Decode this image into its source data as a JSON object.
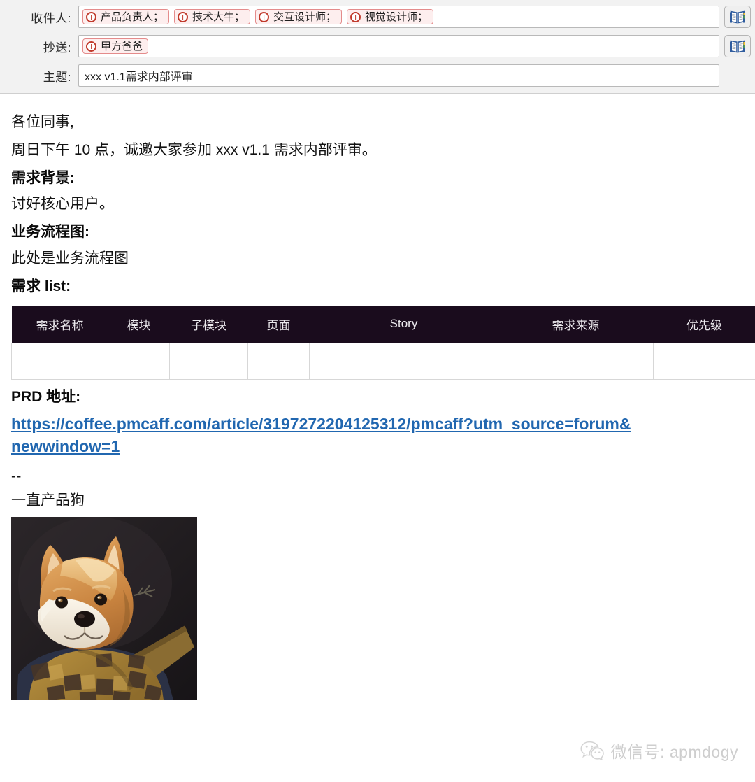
{
  "compose": {
    "fields": [
      {
        "key": "to",
        "label": "收件人:",
        "chips": [
          {
            "label": "产品负责人；",
            "icon": "error-circle-icon"
          },
          {
            "label": "技术大牛；",
            "icon": "error-circle-icon"
          },
          {
            "label": "交互设计师；",
            "icon": "error-circle-icon"
          },
          {
            "label": "视觉设计师；",
            "icon": "error-circle-icon"
          }
        ],
        "has_address_book": true,
        "address_book_icon": "address-book-icon"
      },
      {
        "key": "cc",
        "label": "抄送:",
        "chips": [
          {
            "label": "甲方爸爸",
            "icon": "error-circle-icon"
          }
        ],
        "has_address_book": true,
        "address_book_icon": "address-book-icon"
      },
      {
        "key": "subject",
        "label": "主题:",
        "value": "xxx v1.1需求内部评审",
        "placeholder": "",
        "has_address_book": false
      }
    ]
  },
  "body": {
    "greeting": "各位同事,",
    "intro": "周日下午 10 点，诚邀大家参加 xxx v1.1 需求内部评审。",
    "heading_background": "需求背景:",
    "text_background": "讨好核心用户。",
    "heading_flowchart": "业务流程图:",
    "text_flowchart": "此处是业务流程图",
    "heading_list": "需求 list:",
    "heading_prd": "PRD 地址:",
    "prd_url": "https://coffee.pmcaff.com/article/3197272204125312/pmcaff?utm_source=forum&newwindow=1",
    "signature_separator": "--",
    "signature_name": "一直产品狗"
  },
  "table": {
    "columns": [
      "需求名称",
      "模块",
      "子模块",
      "页面",
      "Story",
      "需求来源",
      "优先级"
    ],
    "rows": [
      [
        "",
        "",
        "",
        "",
        "",
        "",
        ""
      ]
    ],
    "header_bg": "#1a0c1d",
    "header_color": "#eceaee",
    "border_color": "#d7d7d7"
  },
  "watermark": {
    "icon": "wechat-icon",
    "text": "微信号: apmdogy"
  },
  "image": {
    "alt": "shiba-inu-dog-illustration"
  },
  "colors": {
    "header_bg": "#f2f2f2",
    "chip_bg": "#fdeeee",
    "chip_border": "#e48b8b",
    "chip_icon": "#c0392b",
    "link": "#2167b0",
    "table_header": "#1a0c1d"
  }
}
